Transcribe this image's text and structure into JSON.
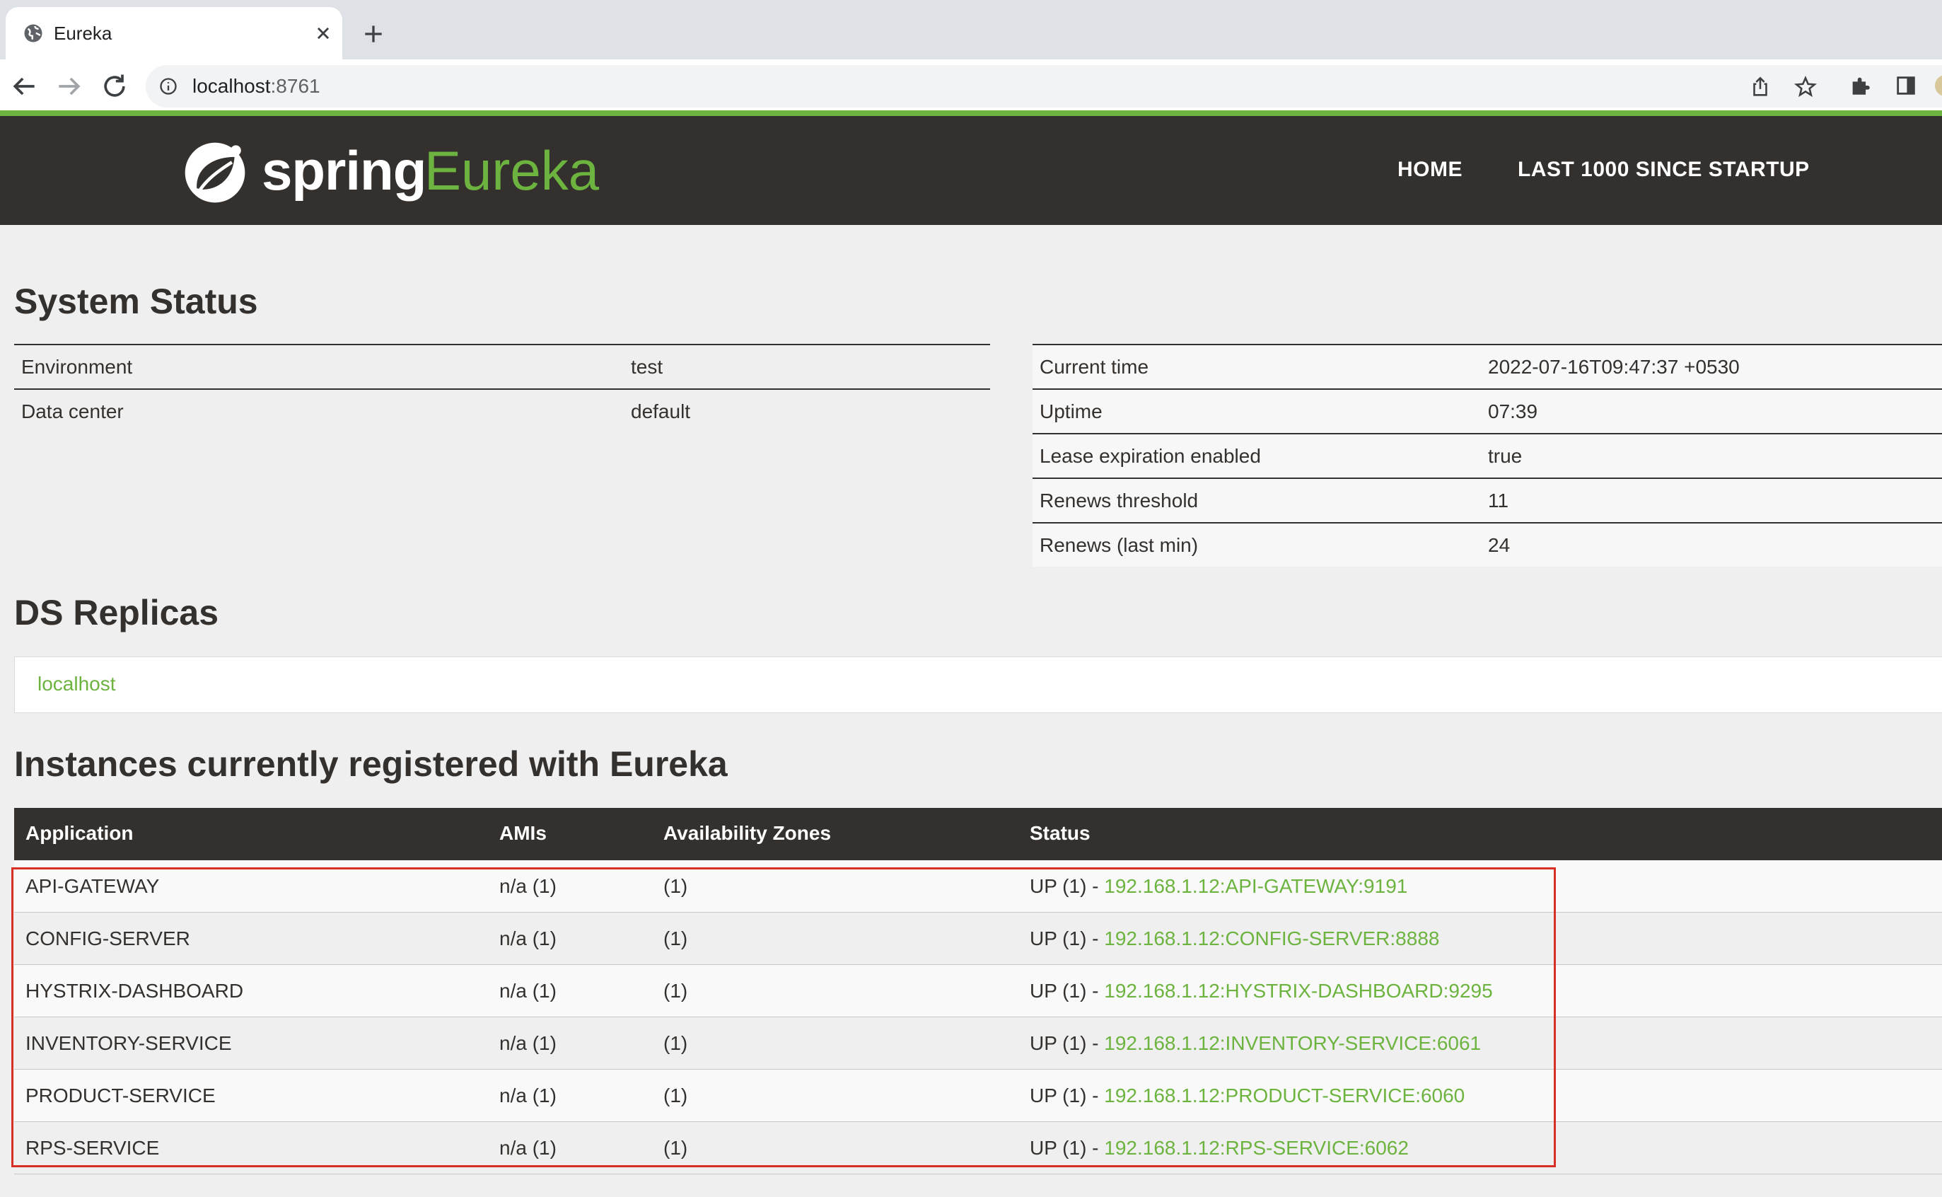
{
  "browser": {
    "tab_title": "Eureka",
    "url_host": "localhost",
    "url_port": ":8761"
  },
  "header": {
    "logo_spring": "spring",
    "logo_eureka": "Eureka",
    "nav_home": "HOME",
    "nav_last1000": "LAST 1000 SINCE STARTUP",
    "accent_color": "#6db33f",
    "bar_color": "#34302d"
  },
  "system_status": {
    "title": "System Status",
    "left": [
      {
        "label": "Environment",
        "value": "test"
      },
      {
        "label": "Data center",
        "value": "default"
      }
    ],
    "right": [
      {
        "label": "Current time",
        "value": "2022-07-16T09:47:37 +0530"
      },
      {
        "label": "Uptime",
        "value": "07:39"
      },
      {
        "label": "Lease expiration enabled",
        "value": "true"
      },
      {
        "label": "Renews threshold",
        "value": "11"
      },
      {
        "label": "Renews (last min)",
        "value": "24"
      }
    ]
  },
  "ds_replicas": {
    "title": "DS Replicas",
    "items": [
      "localhost"
    ]
  },
  "instances": {
    "title": "Instances currently registered with Eureka",
    "headers": [
      "Application",
      "AMIs",
      "Availability Zones",
      "Status"
    ],
    "rows": [
      {
        "app": "API-GATEWAY",
        "amis": "n/a (1)",
        "zones": "(1)",
        "status_prefix": "UP (1) - ",
        "status_link": "192.168.1.12:API-GATEWAY:9191"
      },
      {
        "app": "CONFIG-SERVER",
        "amis": "n/a (1)",
        "zones": "(1)",
        "status_prefix": "UP (1) - ",
        "status_link": "192.168.1.12:CONFIG-SERVER:8888"
      },
      {
        "app": "HYSTRIX-DASHBOARD",
        "amis": "n/a (1)",
        "zones": "(1)",
        "status_prefix": "UP (1) - ",
        "status_link": "192.168.1.12:HYSTRIX-DASHBOARD:9295"
      },
      {
        "app": "INVENTORY-SERVICE",
        "amis": "n/a (1)",
        "zones": "(1)",
        "status_prefix": "UP (1) - ",
        "status_link": "192.168.1.12:INVENTORY-SERVICE:6061"
      },
      {
        "app": "PRODUCT-SERVICE",
        "amis": "n/a (1)",
        "zones": "(1)",
        "status_prefix": "UP (1) - ",
        "status_link": "192.168.1.12:PRODUCT-SERVICE:6060"
      },
      {
        "app": "RPS-SERVICE",
        "amis": "n/a (1)",
        "zones": "(1)",
        "status_prefix": "UP (1) - ",
        "status_link": "192.168.1.12:RPS-SERVICE:6062"
      }
    ]
  }
}
